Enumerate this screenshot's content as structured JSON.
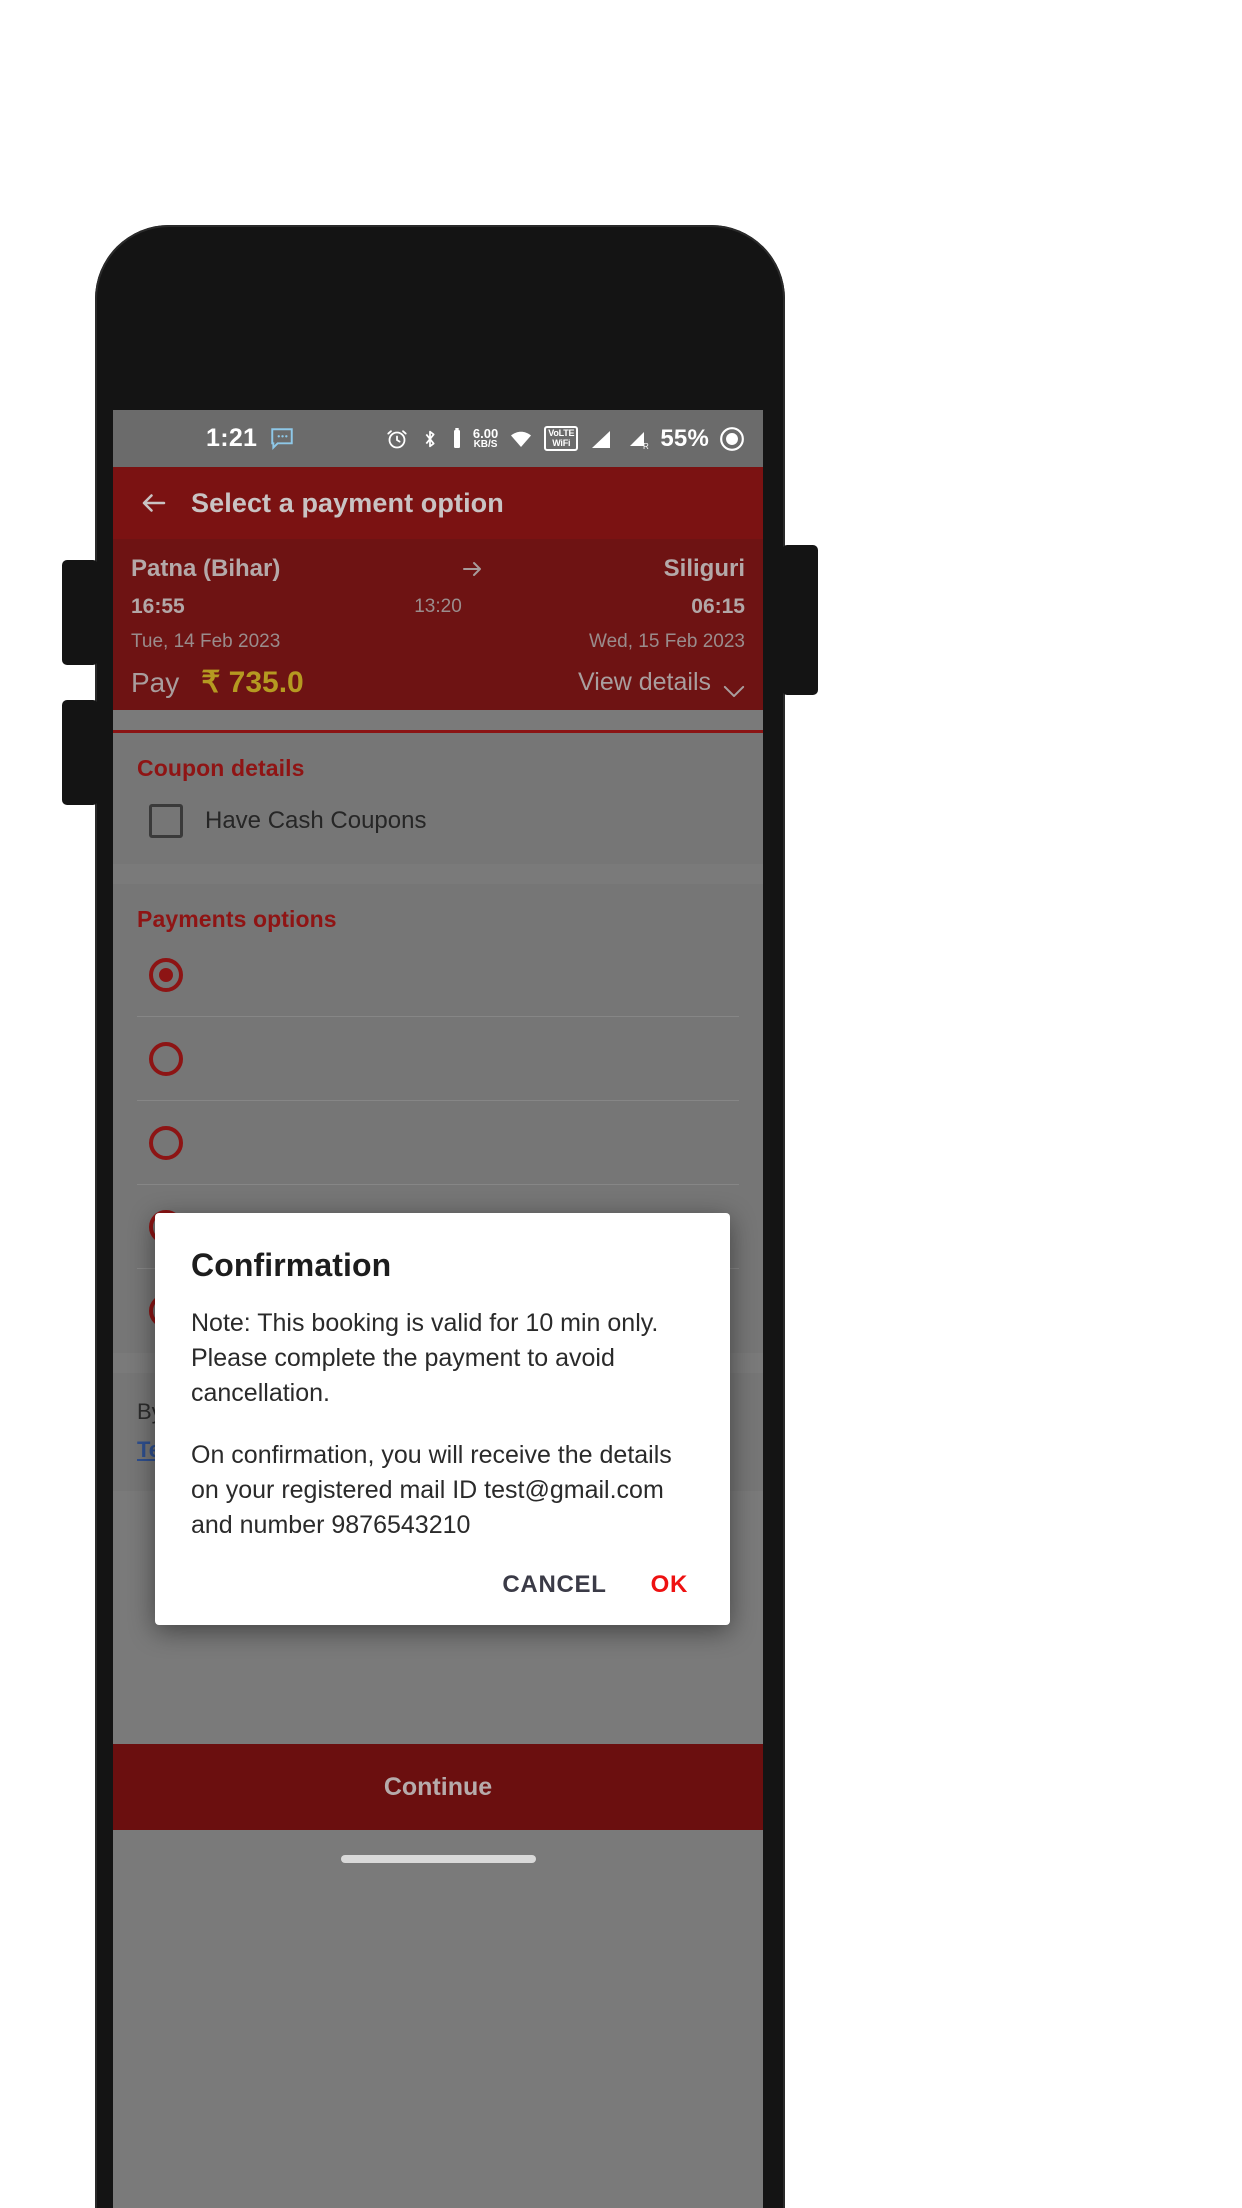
{
  "status_bar": {
    "time": "1:21",
    "notification_icon": "message-icon",
    "alarm_icon": "alarm-icon",
    "bluetooth_icon": "bluetooth-icon",
    "data_rate": "6.00",
    "data_rate_unit": "KB/S",
    "wifi_icon": "wifi-icon",
    "volte_line1": "VoLTE",
    "volte_line2": "WiFi",
    "volte_badge": "1",
    "signal_icon": "signal-bars-icon",
    "signal_roaming_icon": "signal-roaming-icon",
    "roaming_label": "R",
    "battery": "55%",
    "battery_icon": "battery-circle-icon"
  },
  "appbar": {
    "back_icon": "back-arrow-icon",
    "title": "Select a payment option"
  },
  "journey": {
    "origin": "Patna (Bihar)",
    "destination": "Siliguri",
    "arrow_icon": "arrow-right-icon",
    "depart_time": "16:55",
    "duration": "13:20",
    "arrive_time": "06:15",
    "depart_date": "Tue, 14 Feb 2023",
    "arrive_date": "Wed, 15 Feb 2023",
    "pay_label": "Pay",
    "pay_amount": "₹ 735.0",
    "view_details_label": "View details",
    "view_details_icon": "chevron-down-icon"
  },
  "coupon": {
    "title": "Coupon details",
    "checkbox_label": "Have Cash Coupons",
    "checked": false
  },
  "payments": {
    "title": "Payments options",
    "options": [
      {
        "label": "",
        "selected": true
      },
      {
        "label": "",
        "selected": false
      },
      {
        "label": "",
        "selected": false
      },
      {
        "label": "",
        "selected": false
      },
      {
        "label": "",
        "selected": false
      }
    ]
  },
  "terms": {
    "text": "By clicking on continue you agree to all our",
    "link": "Terms and conditions"
  },
  "continue": {
    "label": "Continue"
  },
  "dialog": {
    "title": "Confirmation",
    "paragraph1": "Note: This booking is valid for 10 min only. Please complete the payment to avoid cancellation.",
    "paragraph2": "On confirmation, you will receive the details on your registered mail ID test@gmail.com and number 9876543210",
    "cancel_label": "CANCEL",
    "ok_label": "OK"
  },
  "colors": {
    "brand_dark_red": "#7b1212",
    "brand_red": "#8d1414",
    "amount_gold": "#b59a21",
    "link_blue": "#2e4f8f",
    "ok_red": "#ee1111"
  }
}
